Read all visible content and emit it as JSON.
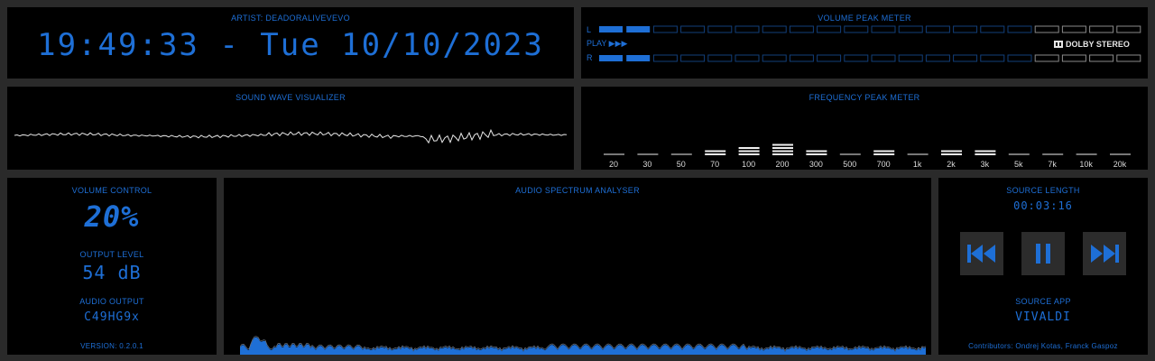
{
  "clock": {
    "artist_label": "ARTIST: DEADORALIVEVEVO",
    "display": "19:49:33 - Tue 10/10/2023"
  },
  "volume_peak": {
    "title": "VOLUME PEAK METER",
    "left_label": "L",
    "right_label": "R",
    "play_label": "PLAY ▶▶▶",
    "left_level": 0.11,
    "right_level": 0.11,
    "dolby_label": "DOLBY STEREO"
  },
  "wave": {
    "title": "SOUND WAVE VISUALIZER"
  },
  "frequency": {
    "title": "FREQUENCY PEAK METER",
    "bands": [
      "20",
      "30",
      "50",
      "70",
      "100",
      "200",
      "300",
      "500",
      "700",
      "1k",
      "2k",
      "3k",
      "5k",
      "7k",
      "10k",
      "20k"
    ],
    "levels": [
      1,
      1,
      1,
      2,
      3,
      4,
      2,
      1,
      2,
      1,
      2,
      2,
      1,
      1,
      1,
      1
    ]
  },
  "volume_control": {
    "title": "VOLUME CONTROL",
    "value": "20%",
    "output_level_title": "OUTPUT LEVEL",
    "output_level_value": "54 dB",
    "audio_output_title": "AUDIO OUTPUT",
    "audio_output_value": "C49HG9x",
    "version": "VERSION: 0.2.0.1"
  },
  "spectrum": {
    "title": "AUDIO SPECTRUM ANALYSER"
  },
  "source": {
    "length_title": "SOURCE LENGTH",
    "length_value": "00:03:16",
    "app_title": "SOURCE APP",
    "app_value": "VIVALDI",
    "contributors": "Contributors: Ondrej Kotas, Franck Gaspoz"
  },
  "icons": {
    "prev": "skip-previous-icon",
    "pause": "pause-icon",
    "next": "skip-next-icon"
  },
  "colors": {
    "accent": "#1e6fd6",
    "panel_bg": "#000000",
    "page_bg": "#2a2a2a"
  }
}
